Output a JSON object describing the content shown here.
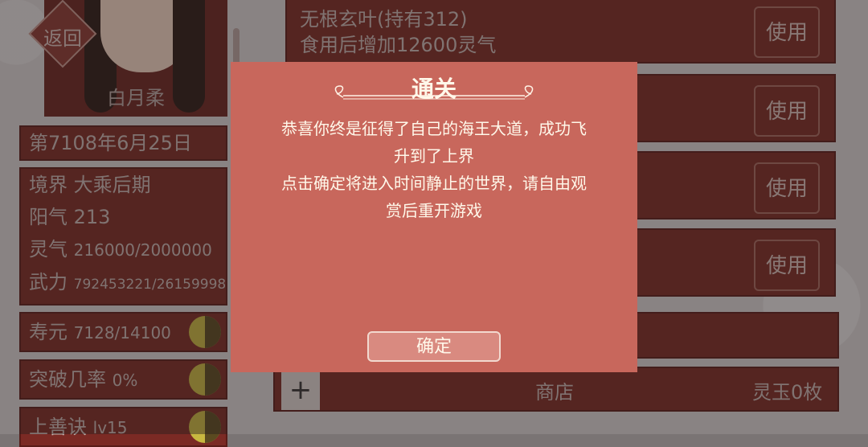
{
  "character": {
    "back_label": "返回",
    "name": "白月柔",
    "date": "第7108年6月25日",
    "stats": [
      {
        "label": "境界",
        "value": "大乘后期"
      },
      {
        "label": "阳气",
        "value": "213"
      },
      {
        "label": "灵气",
        "value": "216000/2000000"
      },
      {
        "label": "武力",
        "value": "792453221/26159998"
      }
    ],
    "bars": [
      {
        "label": "寿元",
        "value": "7128/14100",
        "icon": "yin-yang-icon"
      },
      {
        "label": "突破几率",
        "value": "0%",
        "icon": "yin-yang-icon"
      },
      {
        "label": "上善诀",
        "value": "lv15",
        "icon": "yin-yang-icon"
      }
    ]
  },
  "items": [
    {
      "name": "无根玄叶(持有312)",
      "desc": "食用后增加12600灵气",
      "button": "使用"
    },
    {
      "name": "",
      "desc": "",
      "button": "使用"
    },
    {
      "name": "",
      "desc": "",
      "button": "使用"
    },
    {
      "name": "",
      "desc": "",
      "button": "使用"
    }
  ],
  "shop": {
    "plus_label": "+",
    "label": "商店",
    "currency": "灵玉0枚"
  },
  "modal": {
    "title": "通关",
    "body": "恭喜你终是征得了自己的海王大道，成功飞\n升到了上界\n点击确定将进入时间静止的世界，请自由观\n赏后重开游戏",
    "ok_label": "确定"
  },
  "colors": {
    "modal_bg": "#c8675c",
    "panel": "#7b2a24",
    "text_light": "#fff8ea"
  }
}
